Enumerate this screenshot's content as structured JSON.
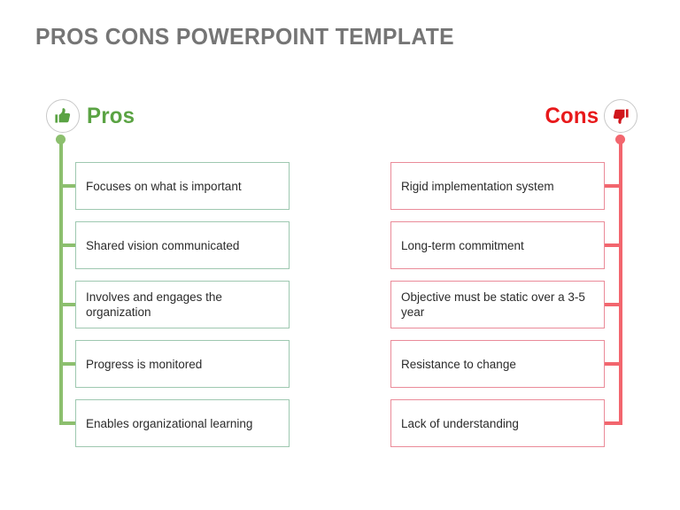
{
  "slide": {
    "title": "PROS CONS POWERPOINT TEMPLATE",
    "background_color": "#ffffff",
    "title_color": "#757575"
  },
  "pros": {
    "label": "Pros",
    "label_color": "#5aa343",
    "icon": "thumbs-up-icon",
    "icon_color": "#5aa343",
    "spine_color": "#8cbf6e",
    "box_border_color": "#9ec8b0",
    "items": [
      {
        "text": "Focuses on what is important"
      },
      {
        "text": "Shared vision communicated"
      },
      {
        "text": "Involves and engages the organization"
      },
      {
        "text": "Progress is monitored"
      },
      {
        "text": "Enables organizational learning"
      }
    ]
  },
  "cons": {
    "label": "Cons",
    "label_color": "#e8191b",
    "icon": "thumbs-down-icon",
    "icon_color": "#d0161c",
    "spine_color": "#f2666e",
    "box_border_color": "#ea8b99",
    "items": [
      {
        "text": "Rigid implementation system"
      },
      {
        "text": "Long-term commitment"
      },
      {
        "text": "Objective must be static over a 3-5 year"
      },
      {
        "text": "Resistance to change"
      },
      {
        "text": "Lack of understanding"
      }
    ]
  }
}
